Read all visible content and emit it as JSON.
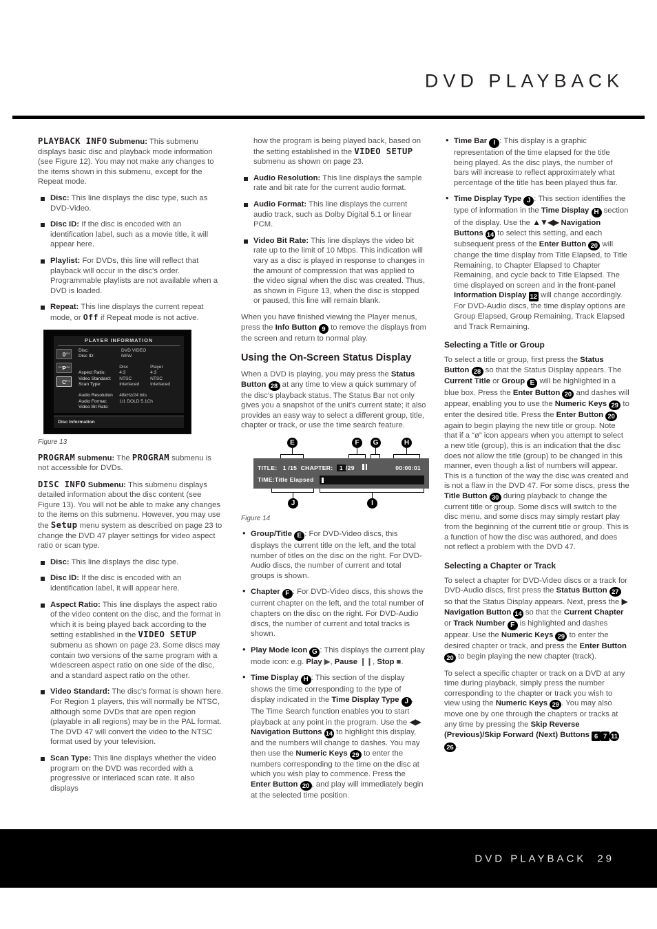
{
  "header": {
    "title": "DVD PLAYBACK"
  },
  "footer": {
    "title": "DVD PLAYBACK",
    "page_number": "29"
  },
  "columns": {
    "left": {
      "playback_info": {
        "term": "PLAYBACK INFO",
        "label": " Submenu:",
        "body": " This submenu displays basic disc and playback mode information (see Figure 12). You may not make any changes to the items shown in this submenu, except for the Repeat mode."
      },
      "bullets": [
        {
          "term": "Disc:",
          "text": " This line displays the disc type, such as DVD-Video."
        },
        {
          "term": "Disc ID:",
          "text": " If the disc is encoded with an identification label, such as a movie title, it will appear here."
        },
        {
          "term": "Playlist:",
          "text": " For DVDs, this line will reflect that playback will occur in the disc's order. Programmable playlists are not available when a DVD is loaded."
        },
        {
          "term": "Repeat:",
          "text_before": " This line displays the current repeat mode, or ",
          "mono": "Off",
          "text_after": " if Repeat mode is not active."
        }
      ],
      "figure13": {
        "caption": "Figure 13",
        "screen_title": "PLAYER INFORMATION",
        "icons": [
          "0",
          "P",
          "C"
        ],
        "icon_labels": [
          "MP3",
          "PICTURE",
          "MP3"
        ],
        "rows_top": [
          {
            "label": "Disc:",
            "c1": "DVD VIDEO",
            "c2": ""
          },
          {
            "label": "Disc ID:",
            "c1": "NEW",
            "c2": ""
          }
        ],
        "column_headers": {
          "label": "",
          "c1": "Disc",
          "c2": "Player"
        },
        "rows_mid": [
          {
            "label": "Aspect Ratio:",
            "c1": "4:3",
            "c2": "4:3"
          },
          {
            "label": "Video Standard:",
            "c1": "NTSC",
            "c2": "NTSC"
          },
          {
            "label": "Scan Type:",
            "c1": "Interlaced",
            "c2": "Interlaced"
          }
        ],
        "rows_bottom": [
          {
            "label": "Audio Resolution",
            "value": "48kHz/24 bits"
          },
          {
            "label": "Audio Format:",
            "value": "1/1 DOLD 5.1Ch"
          },
          {
            "label": "Video Bit Rate:",
            "value": ""
          }
        ],
        "footer": "Disc Information"
      },
      "program": {
        "term": "PROGRAM",
        "label": " submenu:",
        "text_before": " The ",
        "term2": "PROGRAM",
        "text_after": " submenu is not accessible for DVDs."
      },
      "disc_info": {
        "term": "DISC INFO",
        "label": " Submenu:",
        "text_before": " This submenu displays detailed information about the disc content (see Figure 13). You will not be able to make any changes to the items on this submenu. However, you may use the ",
        "mono": "Setup",
        "text_after": " menu system as described on page 23 to change the DVD 47 player settings for video aspect ratio or scan type."
      },
      "disc_info_bullets": [
        {
          "term": "Disc:",
          "text": " This line displays the disc type."
        },
        {
          "term": "Disc ID:",
          "text": " If the disc is encoded with an identification label, it will appear here."
        },
        {
          "term": "Aspect Ratio:",
          "text_before": " This line displays the aspect ratio of the video content on the disc, and the format in which it is being played back according to the setting established in the ",
          "mono": "VIDEO SETUP",
          "text_after": " submenu as shown on page 23. Some discs may contain two versions of the same program with a widescreen aspect ratio on one side of the disc, and a standard aspect ratio on the other."
        },
        {
          "term": "Video Standard:",
          "text": " The disc's format is shown here. For Region 1 players, this will normally be NTSC, although some DVDs that are open region (playable in all regions) may be in the PAL format. The DVD 47 will convert the video to the NTSC format used by your television."
        },
        {
          "term": "Scan Type:",
          "text": " This line displays whether the video program on the DVD was recorded with a progressive or interlaced scan rate. It also displays"
        }
      ]
    },
    "middle": {
      "continuation": {
        "text_before": "how the program is being played back, based on the setting established in the ",
        "mono": "VIDEO SETUP",
        "text_after": " submenu as shown on page 23."
      },
      "bullets": [
        {
          "term": "Audio Resolution:",
          "text": " This line displays the sample rate and bit rate for the current audio format."
        },
        {
          "term": "Audio Format:",
          "text": " This line displays the current audio track, such as Dolby Digital 5.1 or linear PCM."
        },
        {
          "term": "Video Bit Rate:",
          "text": " This line displays the video bit rate up to the limit of 10 Mbps. This indication will vary as a disc is played in response to changes in the amount of compression that was applied to the video signal when the disc was created. Thus, as shown in Figure 13, when the disc is stopped or paused, this line will remain blank."
        }
      ],
      "after_bullets": {
        "text_before": "When you have finished viewing the Player menus, press the ",
        "bold": "Info Button",
        "ref": "9",
        "text_after": " to remove the displays from the screen and return to normal play."
      },
      "heading": "Using the On-Screen Status Display",
      "intro": {
        "t1": "When a DVD is playing, you may press the ",
        "b1": "Status Button",
        "r1": "28",
        "t2": " at any time to view a quick summary of the disc's playback status. The Status Bar not only gives you a snapshot of the unit's current state; it also provides an easy way to select a different group, title, chapter or track, or use the time search feature."
      },
      "figure14": {
        "caption": "Figure 14",
        "callouts": [
          "E",
          "F",
          "G",
          "H",
          "I",
          "J"
        ],
        "title_label": "TITLE:",
        "title_value": "1 /15",
        "chapter_label": "CHAPTER:",
        "chapter_current": "1",
        "chapter_total": "/29",
        "time_value": "00:00:01",
        "time_label": "TIME:",
        "time_type": "Title Elapsed"
      },
      "dot_bullets": [
        {
          "term": "Group/Title",
          "callout": "E",
          "text": ": For DVD-Video discs, this displays the current title on the left, and the total number of titles on the disc on the right. For DVD-Audio discs, the number of current and total groups is shown."
        },
        {
          "term": "Chapter",
          "callout": "F",
          "text": ": For DVD-Video discs, this shows the current chapter on the left, and the total number of chapters on the disc on the right. For DVD-Audio discs, the number of current and total tracks is shown."
        },
        {
          "term": "Play Mode Icon",
          "callout": "G",
          "text": ": This displays the current play mode icon: e.g. ",
          "play": "Play",
          "pause": "Pause",
          "stop": "Stop"
        },
        {
          "term": "Time Display",
          "callout": "H",
          "text": ": This section of the display shows the time corresponding to the type of display indicated in the "
        }
      ],
      "time_display_tail": {
        "b1": "Time Display Type",
        "r1": "J",
        "t1": ". The Time Search function enables you to start playback at any point in the program. Use the ",
        "arrows": "◀▶",
        "b2": "Navigation Buttons",
        "r2": "14",
        "t2": " to highlight this display, and the numbers will change to dashes. You may then use the ",
        "b3": "Numeric Keys",
        "r3": "29",
        "t3": " to enter the numbers corresponding to the time on the disc at which you wish play to commence. Press the ",
        "b4": "Enter Button",
        "r4": "20",
        "t4": ", and play will immediately begin at the selected time position."
      }
    },
    "right": {
      "time_bar": {
        "term": "Time Bar",
        "callout": "I",
        "text": ": This display is a graphic representation of the time elapsed for the title being played. As the disc plays, the number of bars will increase to reflect approximately what percentage of the title has been played thus far."
      },
      "time_display_type": {
        "term": "Time Display Type",
        "callout": "J",
        "t1": ": This section identifies the type of information in the ",
        "b1": "Time Display",
        "r1": "H",
        "t2": " section of the display. Use the ",
        "arrows": "▲▼◀▶",
        "b2": "Navigation Buttons",
        "r2": "14",
        "t3": " to select this setting, and each subsequent press of the ",
        "b3": "Enter Button",
        "r3": "20",
        "t4": " will change the time display from Title Elapsed, to Title Remaining, to Chapter Elapsed to Chapter Remaining, and cycle back to Title Elapsed. The time displayed on screen and in the front-panel ",
        "b4": "Information Display",
        "r4": "12",
        "t5": " will change accordingly. For DVD-Audio discs, the time display options are Group Elapsed, Group Remaining, Track Elapsed and Track Remaining."
      },
      "heading_title": "Selecting a Title or Group",
      "title_body": {
        "t1": "To select a title or group, first press the ",
        "b1": "Status Button",
        "r1": "28",
        "t2": " so that the Status Display appears. The ",
        "b2": "Current Title",
        "t3": " or ",
        "b3": "Group",
        "r3": "E",
        "t4": " will be highlighted in a blue box. Press the ",
        "b4": "Enter Button",
        "r4": "20",
        "t5": " and dashes will appear, enabling you to use the ",
        "b5": "Numeric Keys",
        "r5": "29",
        "t6": " to enter the desired title. Press the ",
        "b6": "Enter Button",
        "r6": "20",
        "t7": " again to begin playing the new title or group. Note that if a “ø” icon appears when you attempt to select a new title (group), this is an indication that the disc does not allow the title (group) to be changed in this manner, even though a list of numbers will appear. This is a function of the way the disc was created and is not a flaw in the DVD 47. For some discs, press the ",
        "b7": "Title Button",
        "r7": "30",
        "t8": " during playback to change the current title or group. Some discs will switch to the disc menu, and some discs may simply restart play from the beginning of the current title or group. This is a function of how the disc was authored, and does not reflect a problem with the DVD 47."
      },
      "heading_chapter": "Selecting a Chapter or Track",
      "chapter_body": {
        "t1": "To select a chapter for DVD-Video discs or a track for DVD-Audio discs, first press the ",
        "b1": "Status Button",
        "r1": "27",
        "t2": " so that the Status Display appears. Next, press the ",
        "arrow": "▶",
        "b2": "Navigation Button",
        "r2": "14",
        "t3": " so that the ",
        "b3": "Current Chapter",
        "t4": " or ",
        "b4": "Track Number",
        "r4": "F",
        "t5": " is highlighted and dashes appear. Use the ",
        "b5": "Numeric Keys",
        "r5": "29",
        "t6": " to enter the desired chapter or track, and press the ",
        "b6": "Enter Button",
        "r6": "20",
        "t7": " to begin playing the new chapter (track)."
      },
      "chapter_body2": {
        "t1": "To select a specific chapter or track on a DVD at any time during playback, simply press the number corresponding to the chapter or track you wish to view using the ",
        "b1": "Numeric Keys",
        "r1": "29",
        "t2": ". You may also move one by one through the chapters or tracks at any time by pressing the ",
        "b2": "Skip Reverse (Previous)/Skip Forward (Next) Buttons",
        "r2a": "6",
        "r2b": "7",
        "r2c": "11",
        "r2d": "26",
        "t3": "."
      }
    }
  }
}
